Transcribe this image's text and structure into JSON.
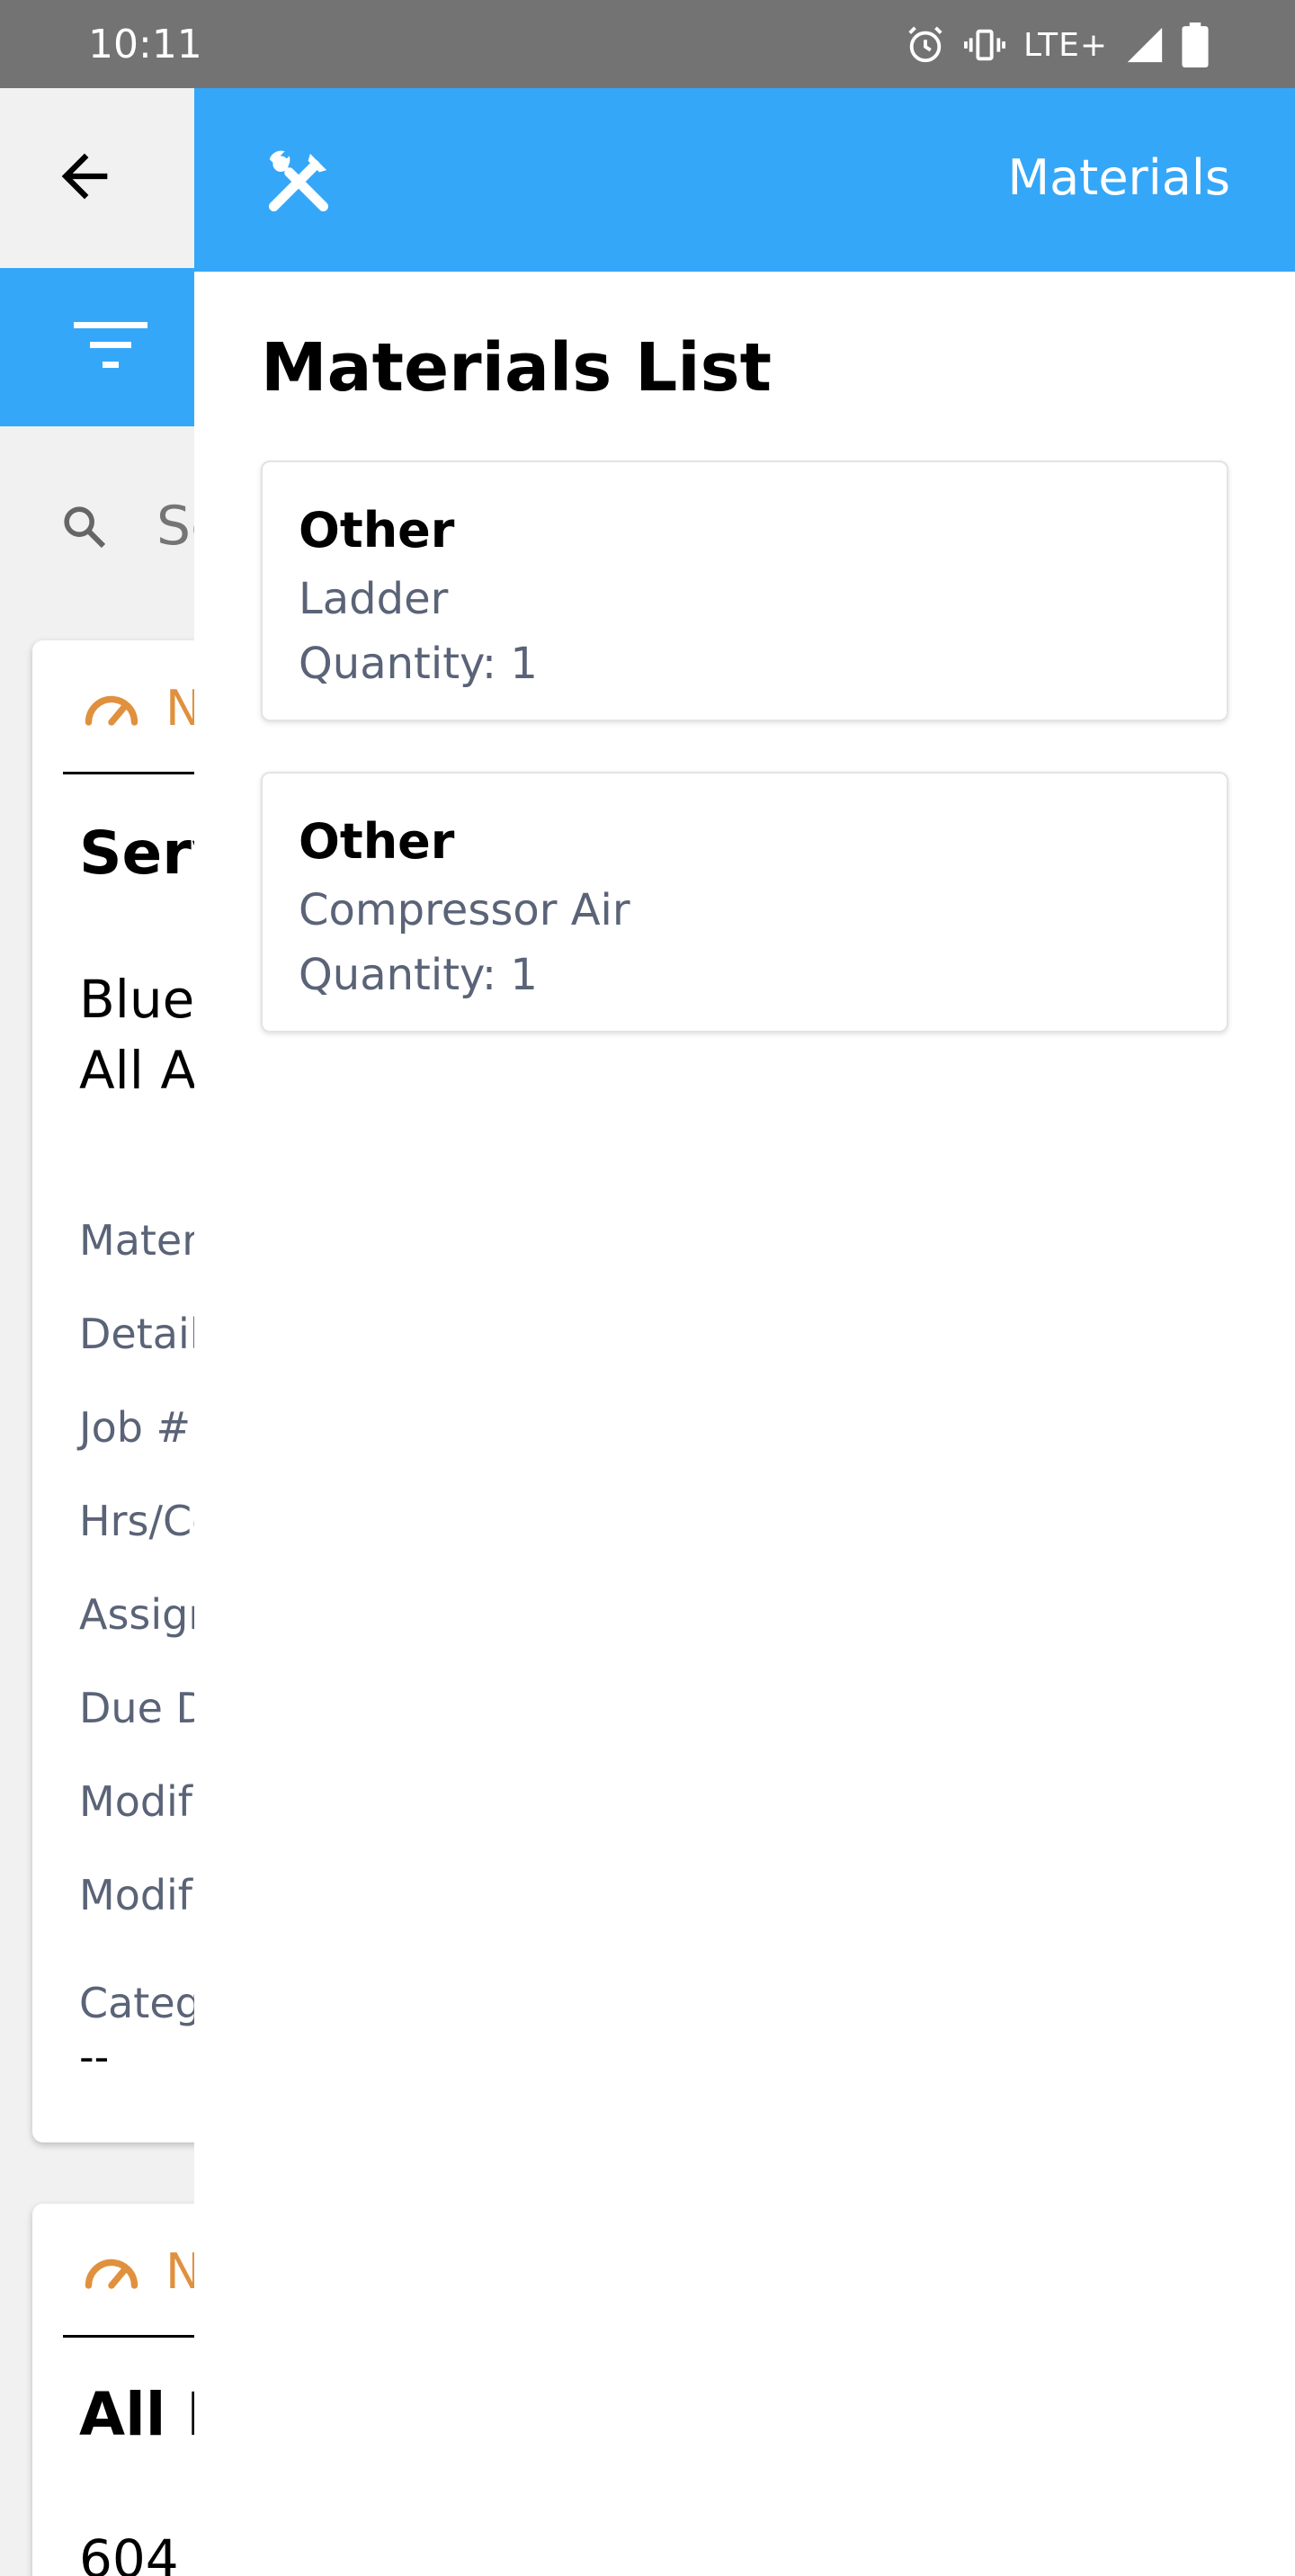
{
  "status_bar": {
    "time": "10:11",
    "network": "LTE+",
    "icons": [
      "alarm-icon",
      "vibrate-icon",
      "signal-icon",
      "battery-icon"
    ]
  },
  "colors": {
    "accent": "#35a7f8",
    "status_bar": "#737373",
    "priority": "#e0913e",
    "muted_text": "#5a6377"
  },
  "background": {
    "search_placeholder": "Se",
    "card1": {
      "header_text": "N",
      "title": "Serv",
      "subtitle_line1": "Blue",
      "subtitle_line2": "All A",
      "fields": [
        "Mater",
        "Detail",
        "Job #:",
        "Hrs/Co",
        "Assign",
        "Due D",
        "Modif",
        "Modif",
        "Categ"
      ],
      "category_value": "--"
    },
    "card2": {
      "header_text": "N",
      "title": "All I",
      "subtitle": "604"
    }
  },
  "drawer": {
    "header_icon": "tools-icon",
    "title": "Materials",
    "list_heading": "Materials List",
    "items": [
      {
        "category": "Other",
        "name": "Ladder",
        "quantity": "Quantity: 1"
      },
      {
        "category": "Other",
        "name": "Compressor Air",
        "quantity": "Quantity: 1"
      }
    ]
  }
}
